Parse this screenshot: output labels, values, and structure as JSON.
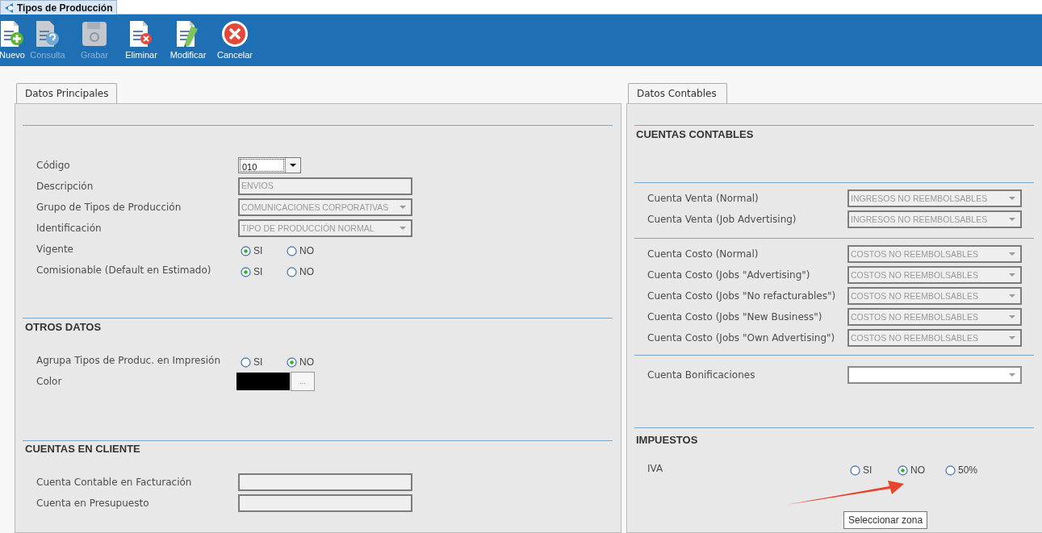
{
  "window_tab": {
    "title": "Tipos de Producción",
    "selected": true
  },
  "toolbar": [
    {
      "kind": "new",
      "label": "Nuevo",
      "disabled": false
    },
    {
      "kind": "query",
      "label": "Consulta",
      "disabled": true
    },
    {
      "kind": "save",
      "label": "Grabar",
      "disabled": true
    },
    {
      "kind": "delete",
      "label": "Eliminar",
      "disabled": false
    },
    {
      "kind": "edit",
      "label": "Modificar",
      "disabled": false
    },
    {
      "kind": "cancel",
      "label": "Cancelar",
      "disabled": false
    }
  ],
  "left_panel": {
    "tab": "Datos Principales",
    "sections": [
      {
        "fields": [
          {
            "kind": "combo",
            "label": "Código",
            "value": "010"
          },
          {
            "kind": "text",
            "label": "Descripción",
            "value": "ENVIOS",
            "disabled": true
          },
          {
            "kind": "select",
            "label": "Grupo de Tipos de Producción",
            "value": "COMUNICACIONES CORPORATIVAS",
            "disabled": true
          },
          {
            "kind": "select",
            "label": "Identificación",
            "value": "TIPO DE PRODUCCIÓN NORMAL",
            "disabled": true
          },
          {
            "kind": "radio",
            "label": "Vigente",
            "options": [
              {
                "label": "SI",
                "selected": true
              },
              {
                "label": "NO",
                "selected": false
              }
            ]
          },
          {
            "kind": "radio",
            "label": "Comisionable (Default en Estimado)",
            "options": [
              {
                "label": "SI",
                "selected": true
              },
              {
                "label": "NO",
                "selected": false
              }
            ]
          }
        ]
      },
      {
        "title": "OTROS DATOS",
        "fields": [
          {
            "kind": "radio",
            "label": "Agrupa Tipos de Produc. en Impresión",
            "options": [
              {
                "label": "SI",
                "selected": false
              },
              {
                "label": "NO",
                "selected": true
              }
            ]
          },
          {
            "kind": "color",
            "label": "Color",
            "color": "#000000",
            "button": "..."
          }
        ]
      },
      {
        "title": "CUENTAS EN CLIENTE",
        "fields": [
          {
            "kind": "text",
            "label": "Cuenta Contable en Facturación",
            "disabled": true
          },
          {
            "kind": "text",
            "label": "Cuenta en Presupuesto",
            "disabled": true
          }
        ]
      }
    ]
  },
  "right_panel": {
    "tab": "Datos Contables",
    "sections": [
      {
        "title": "CUENTAS CONTABLES"
      },
      {
        "fields": [
          {
            "kind": "select",
            "label": "Cuenta Venta (Normal)",
            "value": "INGRESOS NO REEMBOLSABLES",
            "disabled": true
          },
          {
            "kind": "select",
            "label": "Cuenta Venta (Job Advertising)",
            "value": "INGRESOS NO REEMBOLSABLES",
            "disabled": true
          }
        ]
      },
      {
        "fields": [
          {
            "kind": "select",
            "label": "Cuenta Costo (Normal)",
            "value": "COSTOS NO REEMBOLSABLES",
            "disabled": true
          },
          {
            "kind": "select",
            "label": "Cuenta Costo (Jobs \"Advertising\")",
            "value": "COSTOS NO REEMBOLSABLES",
            "disabled": true
          },
          {
            "kind": "select",
            "label": "Cuenta Costo (Jobs \"No refacturables\")",
            "value": "COSTOS NO REEMBOLSABLES",
            "disabled": true
          },
          {
            "kind": "select",
            "label": "Cuenta Costo (Jobs \"New Business\")",
            "value": "COSTOS NO REEMBOLSABLES",
            "disabled": true
          },
          {
            "kind": "select",
            "label": "Cuenta Costo (Jobs \"Own Advertising\")",
            "value": "COSTOS NO REEMBOLSABLES",
            "disabled": true
          }
        ]
      },
      {
        "fields": [
          {
            "kind": "select",
            "label": "Cuenta Bonificaciones",
            "disabled": false
          }
        ]
      },
      {
        "title": "IMPUESTOS",
        "fields": [
          {
            "kind": "radio",
            "label": "IVA",
            "options": [
              {
                "label": "SI",
                "selected": false
              },
              {
                "label": "NO",
                "selected": true
              },
              {
                "label": "50%",
                "selected": false
              }
            ]
          }
        ]
      }
    ]
  },
  "tooltip": {
    "text": "Seleccionar zona"
  }
}
